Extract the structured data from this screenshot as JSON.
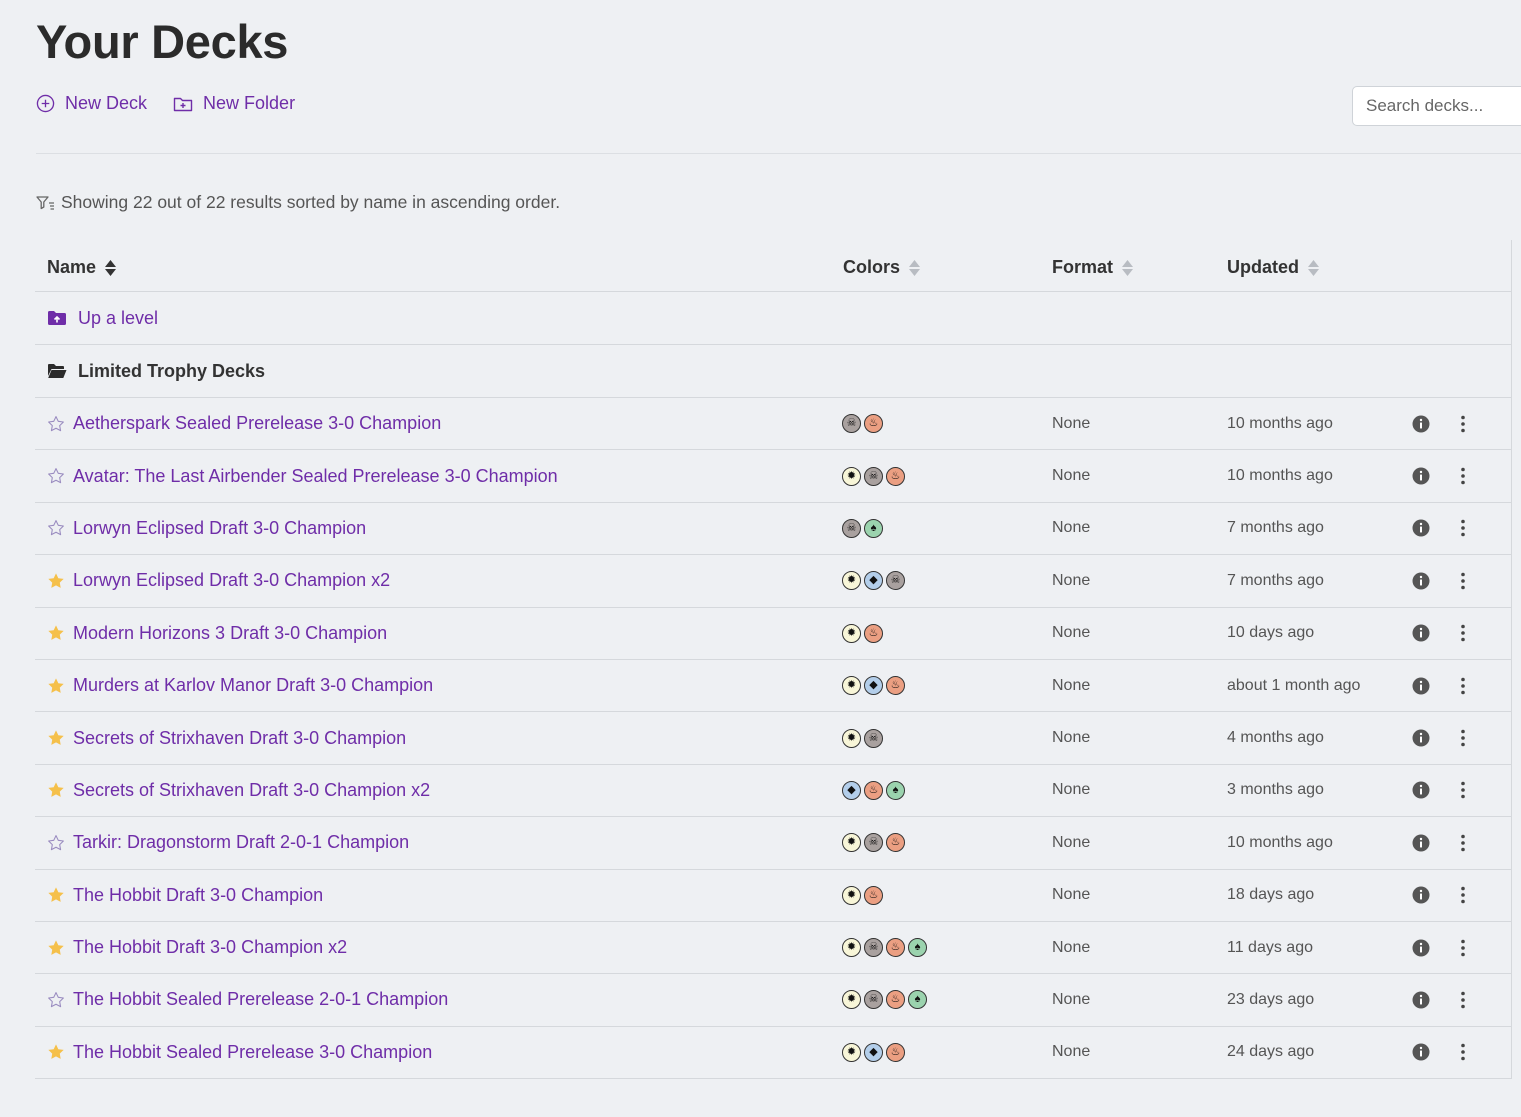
{
  "page": {
    "title": "Your Decks"
  },
  "actions": {
    "new_deck": "New Deck",
    "new_folder": "New Folder"
  },
  "search": {
    "placeholder": "Search decks..."
  },
  "summary": "Showing 22 out of 22 results sorted by name in ascending order.",
  "table": {
    "columns": {
      "name": "Name",
      "colors": "Colors",
      "format": "Format",
      "updated": "Updated"
    },
    "up_level": "Up a level",
    "folder": "Limited Trophy Decks",
    "rows": [
      {
        "name": "Aetherspark Sealed Prerelease 3-0 Champion",
        "favorite": false,
        "colors": [
          "B",
          "R"
        ],
        "format": "None",
        "updated": "10 months ago"
      },
      {
        "name": "Avatar: The Last Airbender Sealed Prerelease 3-0 Champion",
        "favorite": false,
        "colors": [
          "W",
          "B",
          "R"
        ],
        "format": "None",
        "updated": "10 months ago"
      },
      {
        "name": "Lorwyn Eclipsed Draft 3-0 Champion",
        "favorite": false,
        "colors": [
          "B",
          "G"
        ],
        "format": "None",
        "updated": "7 months ago"
      },
      {
        "name": "Lorwyn Eclipsed Draft 3-0 Champion x2",
        "favorite": true,
        "colors": [
          "W",
          "U",
          "B"
        ],
        "format": "None",
        "updated": "7 months ago"
      },
      {
        "name": "Modern Horizons 3 Draft 3-0 Champion",
        "favorite": true,
        "colors": [
          "W",
          "R"
        ],
        "format": "None",
        "updated": "10 days ago"
      },
      {
        "name": "Murders at Karlov Manor Draft 3-0 Champion",
        "favorite": true,
        "colors": [
          "W",
          "U",
          "R"
        ],
        "format": "None",
        "updated": "about 1 month ago"
      },
      {
        "name": "Secrets of Strixhaven Draft 3-0 Champion",
        "favorite": true,
        "colors": [
          "W",
          "B"
        ],
        "format": "None",
        "updated": "4 months ago"
      },
      {
        "name": "Secrets of Strixhaven Draft 3-0 Champion x2",
        "favorite": true,
        "colors": [
          "U",
          "R",
          "G"
        ],
        "format": "None",
        "updated": "3 months ago"
      },
      {
        "name": "Tarkir: Dragonstorm Draft 2-0-1 Champion",
        "favorite": false,
        "colors": [
          "W",
          "B",
          "R"
        ],
        "format": "None",
        "updated": "10 months ago"
      },
      {
        "name": "The Hobbit Draft 3-0 Champion",
        "favorite": true,
        "colors": [
          "W",
          "R"
        ],
        "format": "None",
        "updated": "18 days ago"
      },
      {
        "name": "The Hobbit Draft 3-0 Champion x2",
        "favorite": true,
        "colors": [
          "W",
          "B",
          "R",
          "G"
        ],
        "format": "None",
        "updated": "11 days ago"
      },
      {
        "name": "The Hobbit Sealed Prerelease 2-0-1 Champion",
        "favorite": false,
        "colors": [
          "W",
          "B",
          "R",
          "G"
        ],
        "format": "None",
        "updated": "23 days ago"
      },
      {
        "name": "The Hobbit Sealed Prerelease 3-0 Champion",
        "favorite": true,
        "colors": [
          "W",
          "U",
          "R"
        ],
        "format": "None",
        "updated": "24 days ago"
      }
    ]
  },
  "colors": {
    "accent": "#6f2da8",
    "star_filled": "#f5c04a",
    "star_outline": "#9a8cc0"
  },
  "icons": {
    "W": "sun-icon",
    "U": "water-drop-icon",
    "B": "skull-icon",
    "R": "fire-icon",
    "G": "tree-icon"
  }
}
